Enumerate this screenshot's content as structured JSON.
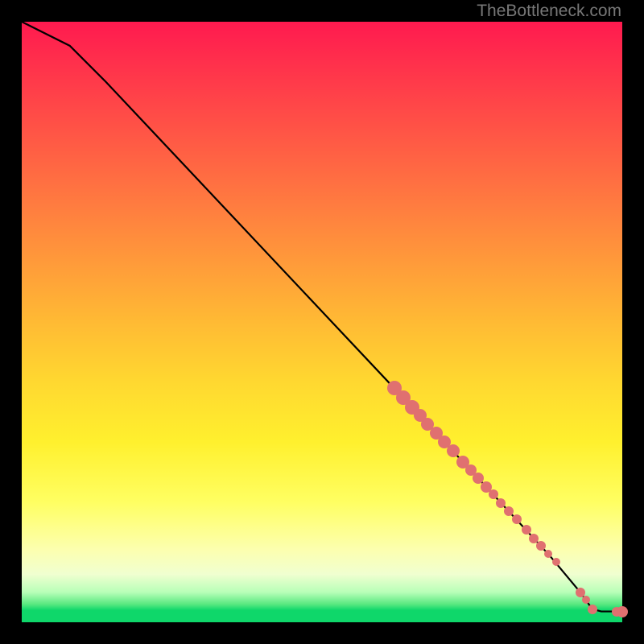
{
  "watermark": "TheBottleneck.com",
  "chart_data": {
    "type": "line",
    "xlim": [
      0,
      100
    ],
    "ylim": [
      0,
      100
    ],
    "curve": [
      {
        "x": 0,
        "y": 100
      },
      {
        "x": 8,
        "y": 96
      },
      {
        "x": 14,
        "y": 90
      },
      {
        "x": 62,
        "y": 39
      },
      {
        "x": 76,
        "y": 24
      },
      {
        "x": 88,
        "y": 11
      },
      {
        "x": 93,
        "y": 5
      },
      {
        "x": 95,
        "y": 2.2
      },
      {
        "x": 96.5,
        "y": 1.8
      },
      {
        "x": 99.5,
        "y": 1.8
      },
      {
        "x": 100,
        "y": 1.8
      }
    ],
    "scatter_series": {
      "color": "#e07070",
      "points": [
        {
          "x": 62,
          "y": 39,
          "r": 9
        },
        {
          "x": 63.5,
          "y": 37.4,
          "r": 9
        },
        {
          "x": 65,
          "y": 35.8,
          "r": 9
        },
        {
          "x": 66.3,
          "y": 34.4,
          "r": 8
        },
        {
          "x": 67.6,
          "y": 33,
          "r": 8
        },
        {
          "x": 69,
          "y": 31.5,
          "r": 8
        },
        {
          "x": 70.4,
          "y": 30,
          "r": 8
        },
        {
          "x": 71.8,
          "y": 28.5,
          "r": 8
        },
        {
          "x": 73.5,
          "y": 26.7,
          "r": 8
        },
        {
          "x": 74.8,
          "y": 25.3,
          "r": 7
        },
        {
          "x": 76,
          "y": 24,
          "r": 7
        },
        {
          "x": 77.4,
          "y": 22.5,
          "r": 7
        },
        {
          "x": 78.5,
          "y": 21.3,
          "r": 6
        },
        {
          "x": 79.8,
          "y": 19.9,
          "r": 6
        },
        {
          "x": 81.1,
          "y": 18.5,
          "r": 6
        },
        {
          "x": 82.4,
          "y": 17.1,
          "r": 6
        },
        {
          "x": 84,
          "y": 15.4,
          "r": 6
        },
        {
          "x": 85.3,
          "y": 14,
          "r": 6
        },
        {
          "x": 86.5,
          "y": 12.7,
          "r": 6
        },
        {
          "x": 87.7,
          "y": 11.4,
          "r": 5
        },
        {
          "x": 89,
          "y": 10,
          "r": 5
        },
        {
          "x": 93,
          "y": 5,
          "r": 6
        },
        {
          "x": 94,
          "y": 3.8,
          "r": 5
        },
        {
          "x": 95,
          "y": 2.2,
          "r": 6
        },
        {
          "x": 99,
          "y": 1.8,
          "r": 6
        },
        {
          "x": 100,
          "y": 1.8,
          "r": 7
        }
      ]
    }
  }
}
